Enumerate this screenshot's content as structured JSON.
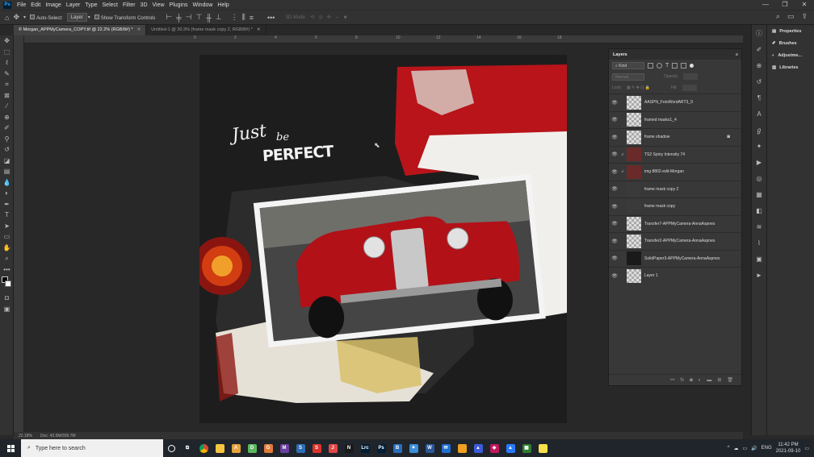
{
  "menubar": {
    "app_icon": "Ps",
    "items": [
      "File",
      "Edit",
      "Image",
      "Layer",
      "Type",
      "Select",
      "Filter",
      "3D",
      "View",
      "Plugins",
      "Window",
      "Help"
    ],
    "window_controls": [
      "—",
      "❐",
      "✕"
    ]
  },
  "options": {
    "auto_select_label": "Auto-Select:",
    "auto_select_value": "Layer",
    "transform_label": "Show Transform Controls",
    "mode_3d_label": "3D Mode:"
  },
  "tabs": [
    {
      "label": "© Morgan_APPMyCamera_COPY.tif @ 22.2% (RGB/8#) *",
      "active": true
    },
    {
      "label": "Untitled-1 @ 30.3% (frame mask copy 2, RGB/8#) *",
      "active": false
    }
  ],
  "ruler_marks": [
    "0",
    "2",
    "4",
    "6",
    "8",
    "10",
    "12",
    "14",
    "16",
    "18"
  ],
  "status": {
    "zoom": "22.18%",
    "doc": "Doc: 43.5M/399.7M"
  },
  "artwork": {
    "title_line1": "Just",
    "title_line2": "be",
    "title_line3": "PERFECT"
  },
  "panels": {
    "items": [
      {
        "name": "Properties",
        "icon": "properties-icon"
      },
      {
        "name": "Brushes",
        "icon": "brush-icon"
      },
      {
        "name": "Adjustme...",
        "icon": "adjustments-icon"
      },
      {
        "name": "Libraries",
        "icon": "libraries-icon"
      }
    ]
  },
  "layers": {
    "title": "Layers",
    "kind_label": "Kind",
    "blend_mode": "Normal",
    "opacity_label": "Opacity:",
    "lock_label": "Lock:",
    "fill_label": "Fill:",
    "items": [
      {
        "name": "AASPN_FotoWordART3_9",
        "linked": false,
        "fx": false,
        "thumb": "transparent"
      },
      {
        "name": "framed masks1_4",
        "linked": false,
        "fx": false,
        "thumb": "transparent"
      },
      {
        "name": "frame shadow",
        "linked": false,
        "fx": true,
        "thumb": "transparent"
      },
      {
        "name": "TS2 Spiny Intensity 74",
        "linked": true,
        "fx": false,
        "thumb": "photo"
      },
      {
        "name": "img 8802-edit-Morgan",
        "linked": true,
        "fx": false,
        "thumb": "photo"
      },
      {
        "name": "frame mask copy 2",
        "linked": false,
        "fx": false,
        "thumb": "dark"
      },
      {
        "name": "frame mask copy",
        "linked": false,
        "fx": false,
        "thumb": "dark"
      },
      {
        "name": "Transfer7-APPMyCamera-AnnaAspnes",
        "linked": false,
        "fx": false,
        "thumb": "transparent"
      },
      {
        "name": "Transfer2-APPMyCamera-AnnaAspnes",
        "linked": false,
        "fx": false,
        "thumb": "transparent"
      },
      {
        "name": "SolidPaper3-APPMyCamera-AnnaAspnes",
        "linked": false,
        "fx": false,
        "thumb": "black"
      },
      {
        "name": "Layer 1",
        "linked": false,
        "fx": false,
        "thumb": "transparent"
      }
    ]
  },
  "taskbar": {
    "search_placeholder": "Type here to search",
    "language": "ENG",
    "time": "11:42 PM",
    "date": "2021-09-10",
    "app_icons": [
      {
        "name": "task-view-icon",
        "color": "#20252b",
        "glyph": "⧉"
      },
      {
        "name": "chrome-icon",
        "color": "#e8b10f",
        "glyph": ""
      },
      {
        "name": "file-explorer-icon",
        "color": "#f5c542",
        "glyph": ""
      },
      {
        "name": "app-a-icon",
        "color": "#e6a23c",
        "glyph": "A"
      },
      {
        "name": "app-d-icon",
        "color": "#5cb85c",
        "glyph": "D"
      },
      {
        "name": "app-g-icon",
        "color": "#e07b39",
        "glyph": "G"
      },
      {
        "name": "app-m-icon",
        "color": "#6a3fa0",
        "glyph": "M"
      },
      {
        "name": "app-s-icon",
        "color": "#2d6db5",
        "glyph": "S"
      },
      {
        "name": "app-red-icon",
        "color": "#d9342b",
        "glyph": "S"
      },
      {
        "name": "app-j-icon",
        "color": "#e0484a",
        "glyph": "J"
      },
      {
        "name": "app-n-icon",
        "color": "#1a1a1a",
        "glyph": "N"
      },
      {
        "name": "lightroom-icon",
        "color": "#001e36",
        "glyph": "Lrc"
      },
      {
        "name": "photoshop-icon",
        "color": "#001e36",
        "glyph": "Ps"
      },
      {
        "name": "app-b-icon",
        "color": "#2a6ebb",
        "glyph": "B"
      },
      {
        "name": "app-bird-icon",
        "color": "#3a8fd9",
        "glyph": "✦"
      },
      {
        "name": "word-icon",
        "color": "#2b579a",
        "glyph": "W"
      },
      {
        "name": "mail-icon",
        "color": "#1f6fd1",
        "glyph": "✉"
      },
      {
        "name": "folder-icon",
        "color": "#f0a020",
        "glyph": ""
      },
      {
        "name": "app-tri-icon",
        "color": "#3b5bdb",
        "glyph": "▲"
      },
      {
        "name": "app-pink-icon",
        "color": "#c2185b",
        "glyph": "◆"
      },
      {
        "name": "app-photo-icon",
        "color": "#2979ff",
        "glyph": "▲"
      },
      {
        "name": "app-green-icon",
        "color": "#2e7d32",
        "glyph": "▦"
      },
      {
        "name": "sticky-notes-icon",
        "color": "#f9e04b",
        "glyph": ""
      }
    ],
    "tray_icons": [
      "^",
      "☁",
      "▭",
      "🔊"
    ]
  },
  "accent": "#31a8ff"
}
